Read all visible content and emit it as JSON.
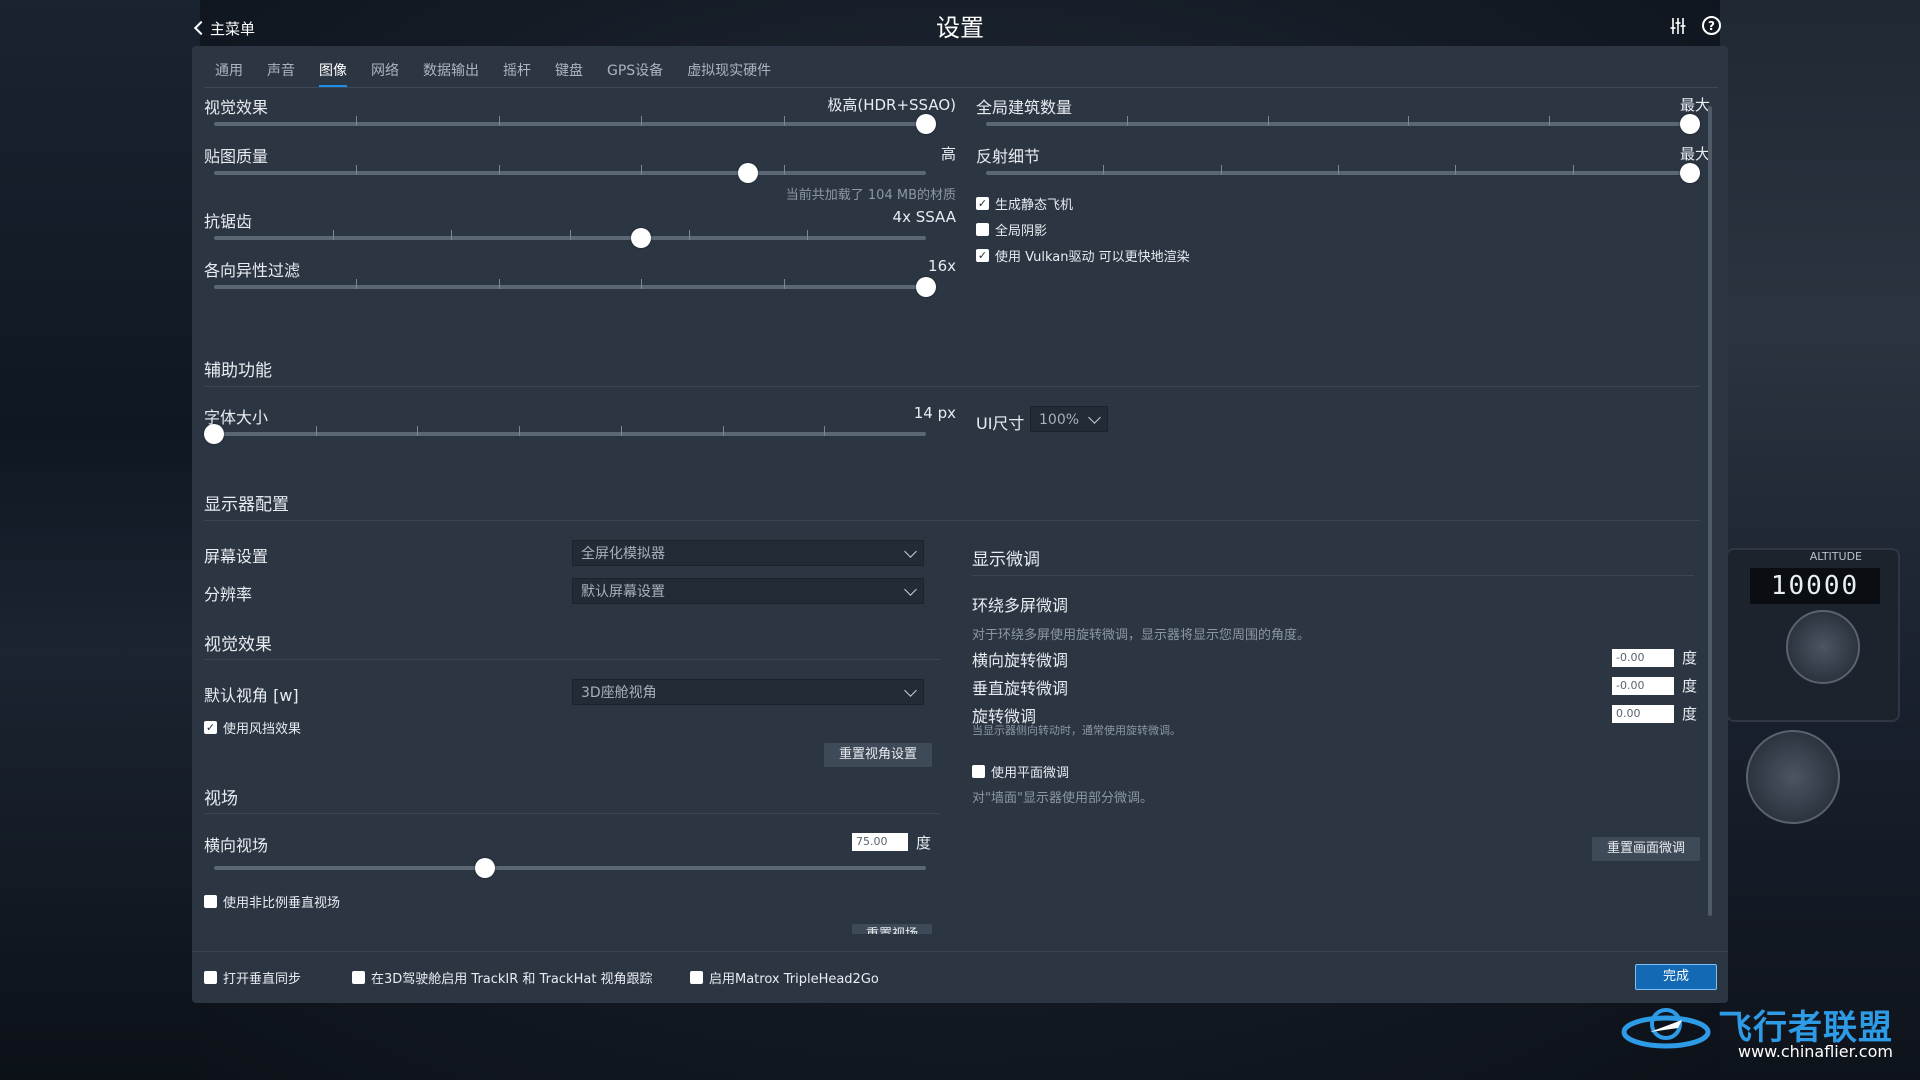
{
  "topbar": {
    "back_label": "主菜单",
    "title": "设置"
  },
  "tabs": [
    {
      "label": "通用",
      "active": false
    },
    {
      "label": "声音",
      "active": false
    },
    {
      "label": "图像",
      "active": true
    },
    {
      "label": "网络",
      "active": false
    },
    {
      "label": "数据输出",
      "active": false
    },
    {
      "label": "摇杆",
      "active": false
    },
    {
      "label": "键盘",
      "active": false
    },
    {
      "label": "GPS设备",
      "active": false
    },
    {
      "label": "虚拟现实硬件",
      "active": false
    }
  ],
  "graphics": {
    "visual_effects": {
      "label": "视觉效果",
      "value": "极高(HDR+SSAO)",
      "level": 1.0
    },
    "texture_quality": {
      "label": "贴图质量",
      "value": "高",
      "level": 0.75,
      "hint": "当前共加载了 104 MB的材质"
    },
    "antialiasing": {
      "label": "抗锯齿",
      "value": "4x SSAA",
      "level": 0.6
    },
    "anisotropic": {
      "label": "各向异性过滤",
      "value": "16x",
      "level": 1.0
    },
    "building_count": {
      "label": "全局建筑数量",
      "value": "最大",
      "level": 1.0
    },
    "reflection_detail": {
      "label": "反射细节",
      "value": "最大",
      "level": 1.0
    },
    "checkboxes": [
      {
        "label": "生成静态飞机",
        "checked": true
      },
      {
        "label": "全局阴影",
        "checked": false
      },
      {
        "label": "使用 Vulkan驱动 可以更快地渲染",
        "checked": true
      }
    ]
  },
  "accessibility": {
    "title": "辅助功能",
    "font_size": {
      "label": "字体大小",
      "value": "14 px",
      "level": 0.0
    },
    "ui_size": {
      "label": "UI尺寸",
      "value": "100%"
    }
  },
  "monitor": {
    "title": "显示器配置",
    "screen_setting": {
      "label": "屏幕设置",
      "value": "全屏化模拟器"
    },
    "resolution": {
      "label": "分辨率",
      "value": "默认屏幕设置"
    },
    "visual_title": "视觉效果",
    "default_view": {
      "label": "默认视角 [w]",
      "value": "3D座舱视角"
    },
    "windshield": {
      "label": "使用风挡效果",
      "checked": true
    },
    "reset_view_button": "重置视角设置",
    "fov_title": "视场",
    "fov": {
      "label": "横向视场",
      "value": "75.00",
      "unit": "度",
      "level": 0.38
    },
    "nonprop_fov": {
      "label": "使用非比例垂直视场",
      "checked": false
    },
    "reset_fov_button": "重置视场"
  },
  "fine_tune": {
    "title": "显示微调",
    "wrap_title": "环绕多屏微调",
    "wrap_desc": "对于环绕多屏使用旋转微调，显示器将显示您周围的角度。",
    "lateral": {
      "label": "横向旋转微调",
      "value": "-0.00",
      "unit": "度"
    },
    "vertical": {
      "label": "垂直旋转微调",
      "value": "-0.00",
      "unit": "度"
    },
    "roll": {
      "label": "旋转微调",
      "value": "0.00",
      "unit": "度",
      "hint": "当显示器侧向转动时，通常使用旋转微调。"
    },
    "flat": {
      "label": "使用平面微调",
      "checked": false,
      "hint": "对\"墙面\"显示器使用部分微调。"
    },
    "reset_button": "重置画面微调"
  },
  "footer": {
    "vsync": {
      "label": "打开垂直同步",
      "checked": false
    },
    "trackir": {
      "label": "在3D驾驶舱启用 TrackIR 和 TrackHat 视角跟踪",
      "checked": false
    },
    "matrox": {
      "label": "启用Matrox TripleHead2Go",
      "checked": false
    },
    "done_button": "完成"
  },
  "background": {
    "altitude_label": "ALTITUDE",
    "altitude_value": "10000"
  },
  "watermark": {
    "title": "飞行者联盟",
    "url": "www.chinaflier.com"
  }
}
